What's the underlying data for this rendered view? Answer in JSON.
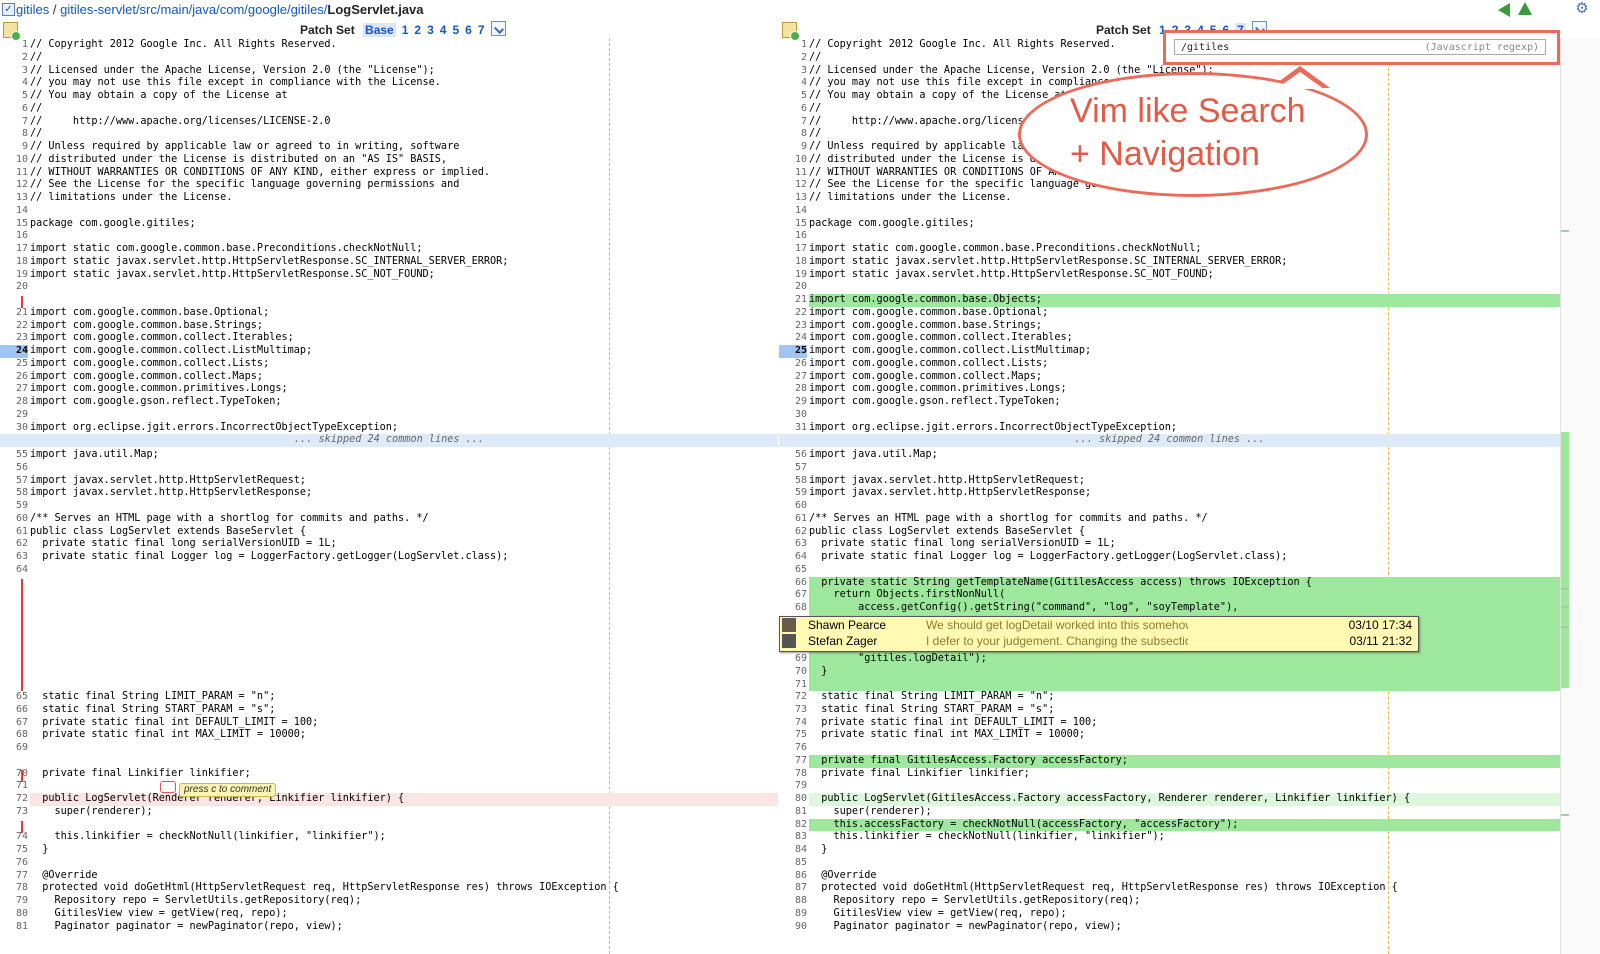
{
  "breadcrumb": {
    "parts": [
      "gitiles",
      "gitiles-servlet/src/main/java/com/google/gitiles/",
      "LogServlet.java"
    ]
  },
  "patch_set": {
    "label": "Patch Set",
    "left_items": [
      "Base",
      "1",
      "2",
      "3",
      "4",
      "5",
      "6",
      "7"
    ],
    "right_items": [
      "1",
      "2",
      "3",
      "4",
      "5",
      "6",
      "7"
    ],
    "left_selected": "Base",
    "right_selected": "7"
  },
  "search": {
    "value": "/gitiles",
    "placeholder": "(Javascript regexp)"
  },
  "callout": {
    "line1": "Vim like Search",
    "line2": "+ Navigation",
    "color": "#ec6a5a"
  },
  "skip_text": "... skipped 24 common lines ...",
  "press_hint": "press c to comment",
  "comments": [
    {
      "author": "Shawn Pearce",
      "message": "We should get logDetail worked into this somehow. logDetail for the ...",
      "date": "03/10 17:34"
    },
    {
      "author": "Stefan Zager",
      "message": "I defer to your judgement. Changing the subsection to \"logDetail\" me...",
      "date": "03/11 21:32"
    }
  ],
  "left": {
    "current_line": "24",
    "lines": [
      {
        "n": "1",
        "t": "// Copyright 2012 Google Inc. All Rights Reserved."
      },
      {
        "n": "2",
        "t": "//"
      },
      {
        "n": "3",
        "t": "// Licensed under the Apache License, Version 2.0 (the \"License\");"
      },
      {
        "n": "4",
        "t": "// you may not use this file except in compliance with the License."
      },
      {
        "n": "5",
        "t": "// You may obtain a copy of the License at"
      },
      {
        "n": "6",
        "t": "//"
      },
      {
        "n": "7",
        "t": "//     http://www.apache.org/licenses/LICENSE-2.0"
      },
      {
        "n": "8",
        "t": "//"
      },
      {
        "n": "9",
        "t": "// Unless required by applicable law or agreed to in writing, software"
      },
      {
        "n": "10",
        "t": "// distributed under the License is distributed on an \"AS IS\" BASIS,"
      },
      {
        "n": "11",
        "t": "// WITHOUT WARRANTIES OR CONDITIONS OF ANY KIND, either express or implied."
      },
      {
        "n": "12",
        "t": "// See the License for the specific language governing permissions and"
      },
      {
        "n": "13",
        "t": "// limitations under the License."
      },
      {
        "n": "14",
        "t": ""
      },
      {
        "n": "15",
        "t": "package com.google.gitiles;"
      },
      {
        "n": "16",
        "t": ""
      },
      {
        "n": "17",
        "t": "import static com.google.common.base.Preconditions.checkNotNull;"
      },
      {
        "n": "18",
        "t": "import static javax.servlet.http.HttpServletResponse.SC_INTERNAL_SERVER_ERROR;"
      },
      {
        "n": "19",
        "t": "import static javax.servlet.http.HttpServletResponse.SC_NOT_FOUND;"
      },
      {
        "n": "20",
        "t": ""
      },
      {
        "n": "",
        "t": ""
      },
      {
        "n": "21",
        "t": "import com.google.common.base.Optional;"
      },
      {
        "n": "22",
        "t": "import com.google.common.base.Strings;"
      },
      {
        "n": "23",
        "t": "import com.google.common.collect.Iterables;"
      },
      {
        "n": "24",
        "t": "import com.google.common.collect.ListMultimap;"
      },
      {
        "n": "25",
        "t": "import com.google.common.collect.Lists;"
      },
      {
        "n": "26",
        "t": "import com.google.common.collect.Maps;"
      },
      {
        "n": "27",
        "t": "import com.google.common.primitives.Longs;"
      },
      {
        "n": "28",
        "t": "import com.google.gson.reflect.TypeToken;"
      },
      {
        "n": "29",
        "t": ""
      },
      {
        "n": "30",
        "t": "import org.eclipse.jgit.errors.IncorrectObjectTypeException;"
      }
    ],
    "lines2": [
      {
        "n": "55",
        "t": "import java.util.Map;"
      },
      {
        "n": "56",
        "t": ""
      },
      {
        "n": "57",
        "t": "import javax.servlet.http.HttpServletRequest;"
      },
      {
        "n": "58",
        "t": "import javax.servlet.http.HttpServletResponse;"
      },
      {
        "n": "59",
        "t": ""
      },
      {
        "n": "60",
        "t": "/** Serves an HTML page with a shortlog for commits and paths. */"
      },
      {
        "n": "61",
        "t": "public class LogServlet extends BaseServlet {"
      },
      {
        "n": "62",
        "t": "  private static final long serialVersionUID = 1L;"
      },
      {
        "n": "63",
        "t": "  private static final Logger log = LoggerFactory.getLogger(LogServlet.class);"
      },
      {
        "n": "64",
        "t": ""
      }
    ],
    "lines3": [
      {
        "n": "65",
        "t": "  static final String LIMIT_PARAM = \"n\";"
      },
      {
        "n": "66",
        "t": "  static final String START_PARAM = \"s\";"
      },
      {
        "n": "67",
        "t": "  private static final int DEFAULT_LIMIT = 100;"
      },
      {
        "n": "68",
        "t": "  private static final int MAX_LIMIT = 10000;"
      },
      {
        "n": "69",
        "t": ""
      },
      {
        "n": "",
        "t": ""
      },
      {
        "n": "70",
        "t": "  private final Linkifier linkifier;"
      },
      {
        "n": "71",
        "t": ""
      },
      {
        "n": "72",
        "t": "  public LogServlet(Renderer renderer, Linkifier linkifier) {"
      },
      {
        "n": "73",
        "t": "    super(renderer);"
      },
      {
        "n": "",
        "t": ""
      },
      {
        "n": "74",
        "t": "    this.linkifier = checkNotNull(linkifier, \"linkifier\");"
      },
      {
        "n": "75",
        "t": "  }"
      },
      {
        "n": "76",
        "t": ""
      },
      {
        "n": "77",
        "t": "  @Override"
      },
      {
        "n": "78",
        "t": "  protected void doGetHtml(HttpServletRequest req, HttpServletResponse res) throws IOException {"
      },
      {
        "n": "79",
        "t": "    Repository repo = ServletUtils.getRepository(req);"
      },
      {
        "n": "80",
        "t": "    GitilesView view = getView(req, repo);"
      },
      {
        "n": "81",
        "t": "    Paginator paginator = newPaginator(repo, view);"
      }
    ]
  },
  "right": {
    "current_line": "25",
    "lines": [
      {
        "n": "1",
        "t": "// Copyright 2012 Google Inc. All Rights Reserved."
      },
      {
        "n": "2",
        "t": "//"
      },
      {
        "n": "3",
        "t": "// Licensed under the Apache License, Version 2.0 (the \"License\");"
      },
      {
        "n": "4",
        "t": "// you may not use this file except in compliance with the License."
      },
      {
        "n": "5",
        "t": "// You may obtain a copy of the License at"
      },
      {
        "n": "6",
        "t": "//"
      },
      {
        "n": "7",
        "t": "//     http://www.apache.org/licenses/LICENSE-2.0"
      },
      {
        "n": "8",
        "t": "//"
      },
      {
        "n": "9",
        "t": "// Unless required by applicable law or agreed to in writing, software"
      },
      {
        "n": "10",
        "t": "// distributed under the License is distributed on an \"AS IS\" BASIS,"
      },
      {
        "n": "11",
        "t": "// WITHOUT WARRANTIES OR CONDITIONS OF ANY KIND, either express or implied."
      },
      {
        "n": "12",
        "t": "// See the License for the specific language governing permissions and"
      },
      {
        "n": "13",
        "t": "// limitations under the License."
      },
      {
        "n": "14",
        "t": ""
      },
      {
        "n": "15",
        "t": "package com.google.gitiles;"
      },
      {
        "n": "16",
        "t": ""
      },
      {
        "n": "17",
        "t": "import static com.google.common.base.Preconditions.checkNotNull;"
      },
      {
        "n": "18",
        "t": "import static javax.servlet.http.HttpServletResponse.SC_INTERNAL_SERVER_ERROR;"
      },
      {
        "n": "19",
        "t": "import static javax.servlet.http.HttpServletResponse.SC_NOT_FOUND;"
      },
      {
        "n": "20",
        "t": ""
      },
      {
        "n": "21",
        "t": "import com.google.common.base.Objects;",
        "ins": true
      },
      {
        "n": "22",
        "t": "import com.google.common.base.Optional;"
      },
      {
        "n": "23",
        "t": "import com.google.common.base.Strings;"
      },
      {
        "n": "24",
        "t": "import com.google.common.collect.Iterables;"
      },
      {
        "n": "25",
        "t": "import com.google.common.collect.ListMultimap;"
      },
      {
        "n": "26",
        "t": "import com.google.common.collect.Lists;"
      },
      {
        "n": "27",
        "t": "import com.google.common.collect.Maps;"
      },
      {
        "n": "28",
        "t": "import com.google.common.primitives.Longs;"
      },
      {
        "n": "29",
        "t": "import com.google.gson.reflect.TypeToken;"
      },
      {
        "n": "30",
        "t": ""
      },
      {
        "n": "31",
        "t": "import org.eclipse.jgit.errors.IncorrectObjectTypeException;"
      }
    ],
    "lines2": [
      {
        "n": "56",
        "t": "import java.util.Map;"
      },
      {
        "n": "57",
        "t": ""
      },
      {
        "n": "58",
        "t": "import javax.servlet.http.HttpServletRequest;"
      },
      {
        "n": "59",
        "t": "import javax.servlet.http.HttpServletResponse;"
      },
      {
        "n": "60",
        "t": ""
      },
      {
        "n": "61",
        "t": "/** Serves an HTML page with a shortlog for commits and paths. */"
      },
      {
        "n": "62",
        "t": "public class LogServlet extends BaseServlet {"
      },
      {
        "n": "63",
        "t": "  private static final long serialVersionUID = 1L;"
      },
      {
        "n": "64",
        "t": "  private static final Logger log = LoggerFactory.getLogger(LogServlet.class);"
      },
      {
        "n": "65",
        "t": ""
      },
      {
        "n": "66",
        "t": "  private static String getTemplateName(GitilesAccess access) throws IOException {",
        "ins": true
      },
      {
        "n": "67",
        "t": "    return Objects.firstNonNull(",
        "ins": true
      },
      {
        "n": "68",
        "t": "        access.getConfig().getString(\"command\", \"log\", \"soyTemplate\"),",
        "ins": true
      }
    ],
    "lines2b": [
      {
        "n": "69",
        "t": "        \"gitiles.logDetail\");",
        "ins": true
      },
      {
        "n": "70",
        "t": "  }",
        "ins": true
      },
      {
        "n": "71",
        "t": "",
        "ins": true
      }
    ],
    "lines3": [
      {
        "n": "72",
        "t": "  static final String LIMIT_PARAM = \"n\";"
      },
      {
        "n": "73",
        "t": "  static final String START_PARAM = \"s\";"
      },
      {
        "n": "74",
        "t": "  private static final int DEFAULT_LIMIT = 100;"
      },
      {
        "n": "75",
        "t": "  private static final int MAX_LIMIT = 10000;"
      },
      {
        "n": "76",
        "t": ""
      },
      {
        "n": "77",
        "t": "  private final GitilesAccess.Factory accessFactory;",
        "ins": true
      },
      {
        "n": "78",
        "t": "  private final Linkifier linkifier;"
      },
      {
        "n": "79",
        "t": ""
      },
      {
        "n": "80",
        "t": "  public LogServlet(GitilesAccess.Factory accessFactory, Renderer renderer, Linkifier linkifier) {",
        "insl": true
      },
      {
        "n": "81",
        "t": "    super(renderer);"
      },
      {
        "n": "82",
        "t": "    this.accessFactory = checkNotNull(accessFactory, \"accessFactory\");",
        "ins": true
      },
      {
        "n": "83",
        "t": "    this.linkifier = checkNotNull(linkifier, \"linkifier\");"
      },
      {
        "n": "84",
        "t": "  }"
      },
      {
        "n": "85",
        "t": ""
      },
      {
        "n": "86",
        "t": "  @Override"
      },
      {
        "n": "87",
        "t": "  protected void doGetHtml(HttpServletRequest req, HttpServletResponse res) throws IOException {"
      },
      {
        "n": "88",
        "t": "    Repository repo = ServletUtils.getRepository(req);"
      },
      {
        "n": "89",
        "t": "    GitilesView view = getView(req, repo);"
      },
      {
        "n": "90",
        "t": "    Paginator paginator = newPaginator(repo, view);"
      }
    ]
  }
}
